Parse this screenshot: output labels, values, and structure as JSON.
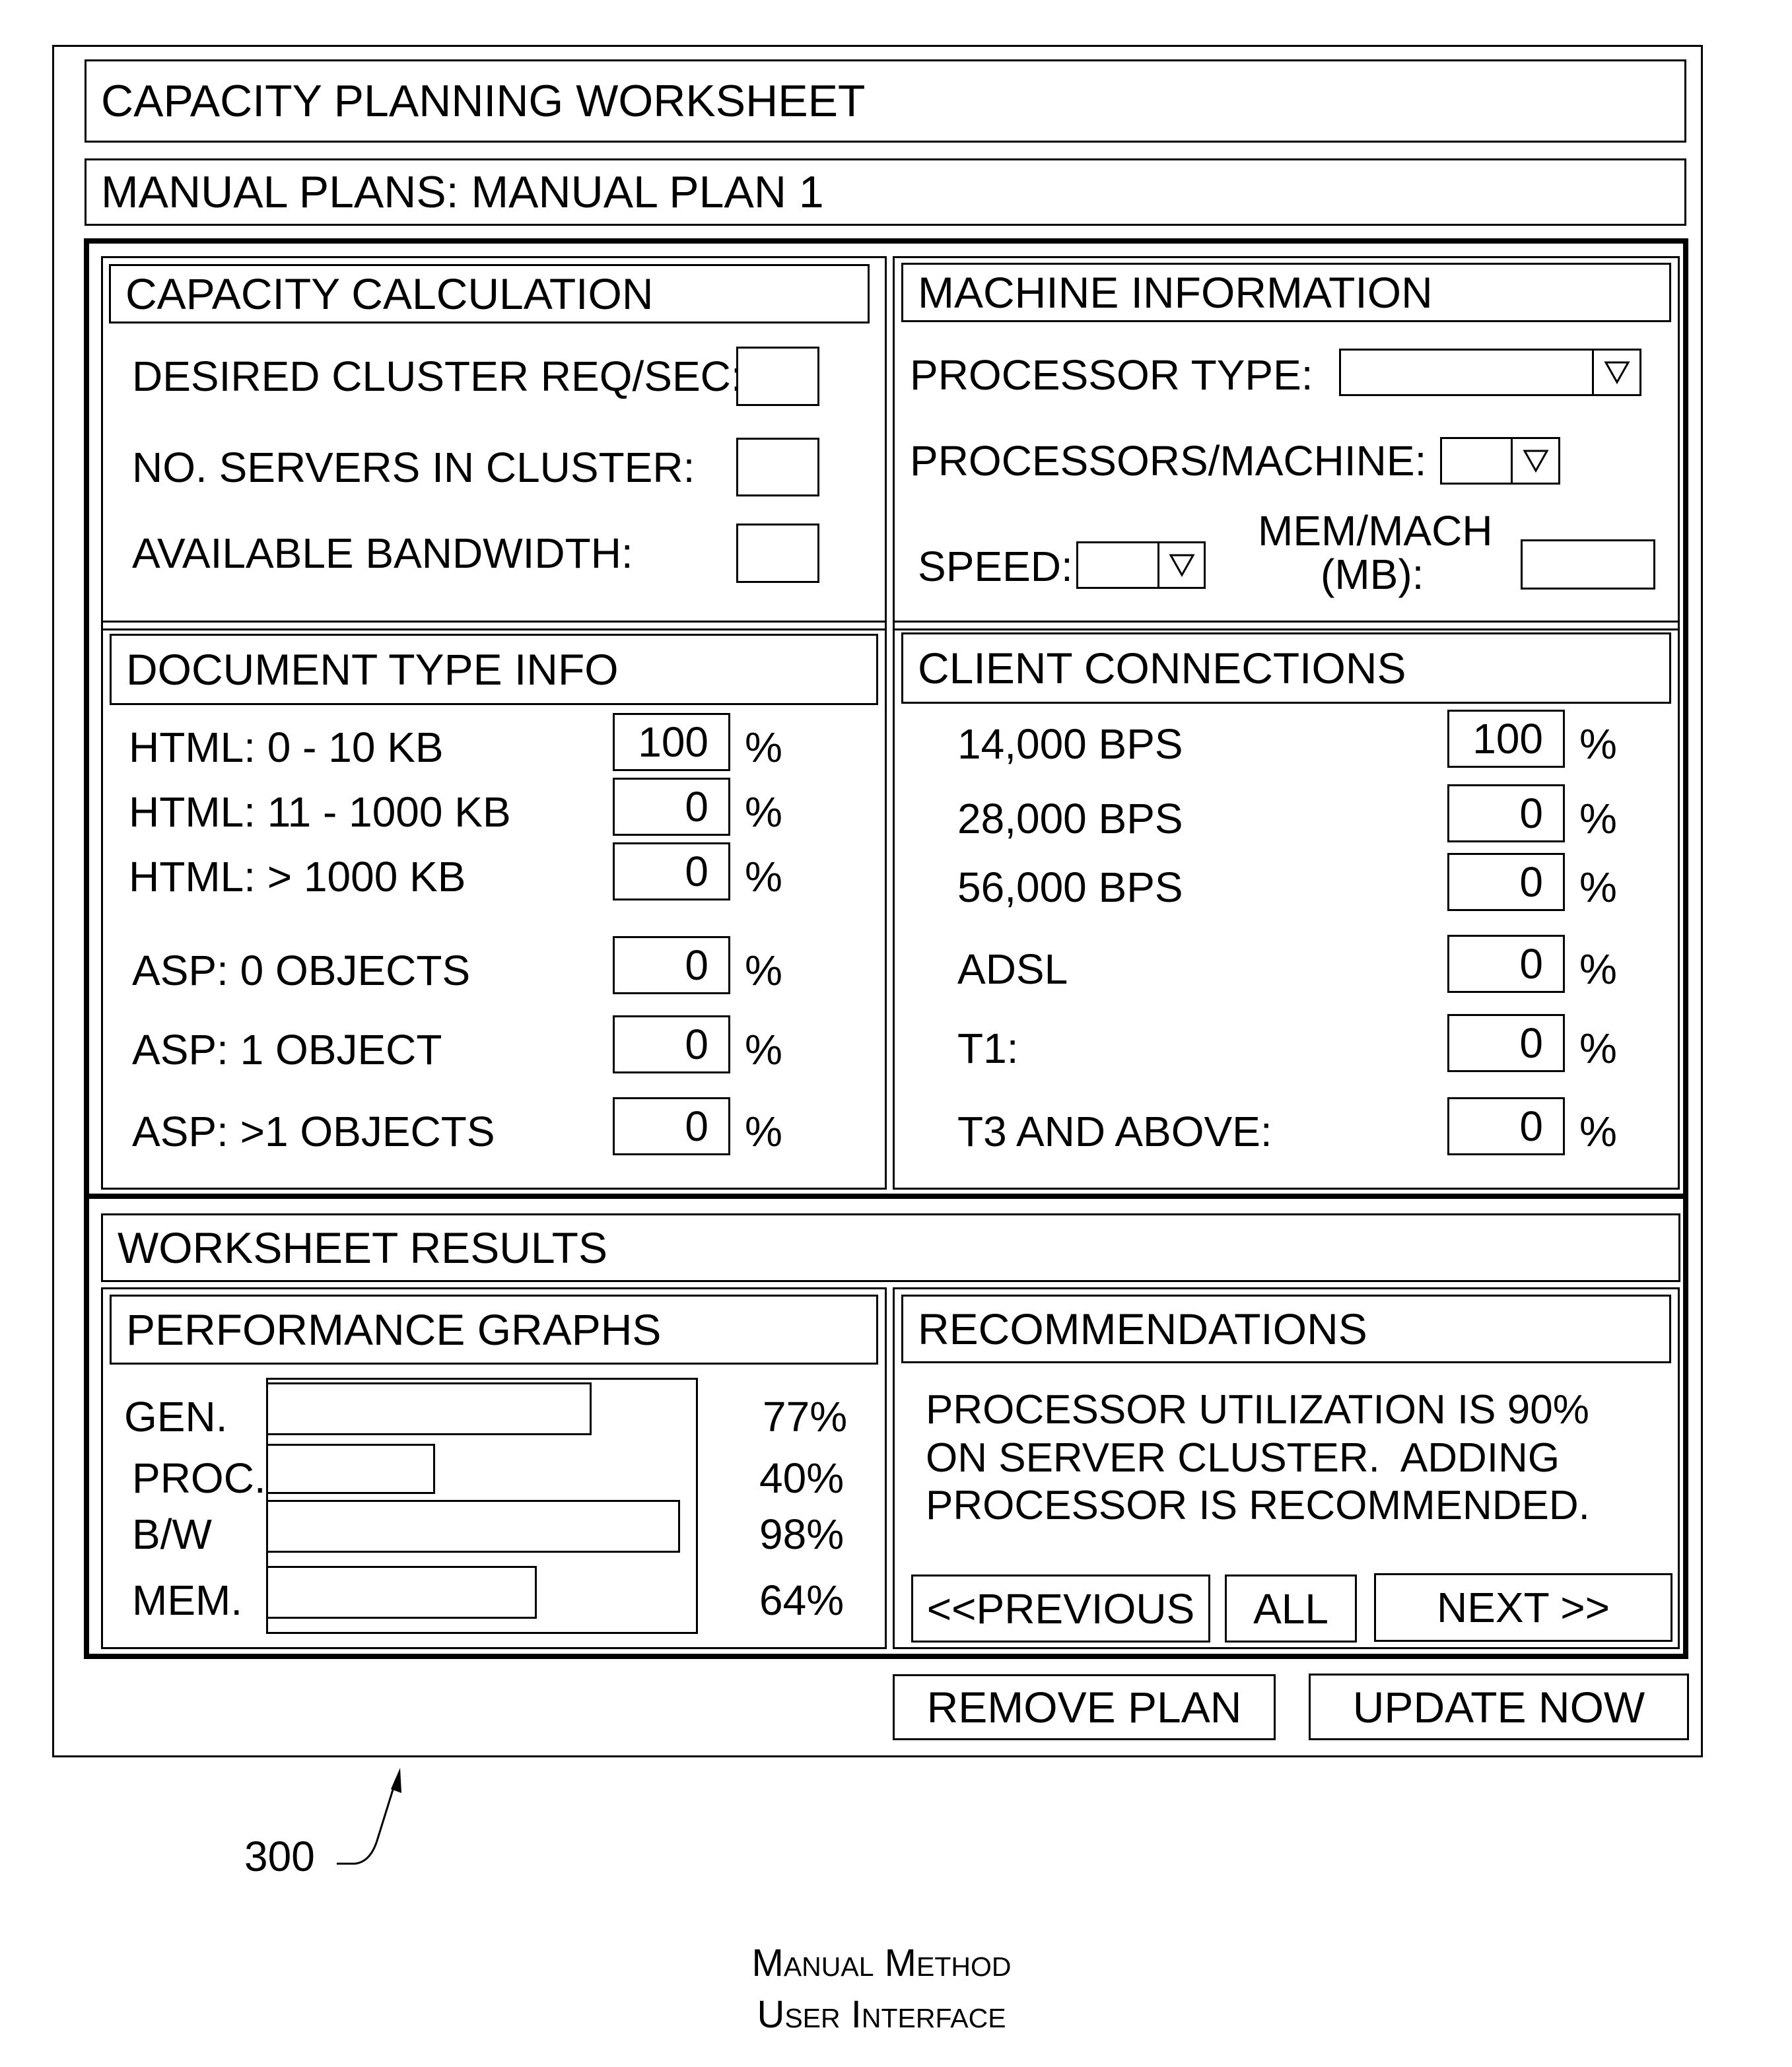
{
  "window": {
    "title": "CAPACITY PLANNING WORKSHEET",
    "plan_label": "MANUAL PLANS: MANUAL PLAN 1"
  },
  "capacity_calculation": {
    "header": "CAPACITY CALCULATION",
    "fields": [
      {
        "label": "DESIRED CLUSTER REQ/SEC:",
        "value": ""
      },
      {
        "label": "NO. SERVERS IN CLUSTER:",
        "value": ""
      },
      {
        "label": "AVAILABLE BANDWIDTH:",
        "value": ""
      }
    ]
  },
  "machine_information": {
    "header": "MACHINE INFORMATION",
    "processor_type": {
      "label": "PROCESSOR TYPE:",
      "value": ""
    },
    "processors_per_machine": {
      "label": "PROCESSORS/MACHINE:",
      "value": ""
    },
    "speed": {
      "label": "SPEED:",
      "value": ""
    },
    "mem_per_machine": {
      "label_line1": "MEM/MACH",
      "label_line2": "(MB):",
      "value": ""
    },
    "dropdown_icon": "triangle-down-icon"
  },
  "document_type_info": {
    "header": "DOCUMENT TYPE INFO",
    "unit": "%",
    "rows": [
      {
        "label": "HTML: 0 - 10 KB",
        "value": "100"
      },
      {
        "label": "HTML: 11 - 1000 KB",
        "value": "0"
      },
      {
        "label": "HTML: > 1000 KB",
        "value": "0"
      },
      {
        "label": "ASP: 0 OBJECTS",
        "value": "0"
      },
      {
        "label": "ASP: 1 OBJECT",
        "value": "0"
      },
      {
        "label": "ASP: >1 OBJECTS",
        "value": "0"
      }
    ]
  },
  "client_connections": {
    "header": "CLIENT CONNECTIONS",
    "unit": "%",
    "rows": [
      {
        "label": "14,000 BPS",
        "value": "100"
      },
      {
        "label": "28,000 BPS",
        "value": "0"
      },
      {
        "label": "56,000 BPS",
        "value": "0"
      },
      {
        "label": "ADSL",
        "value": "0"
      },
      {
        "label": "T1:",
        "value": "0"
      },
      {
        "label": "T3 AND ABOVE:",
        "value": "0"
      }
    ]
  },
  "worksheet_results": {
    "header": "WORKSHEET RESULTS"
  },
  "performance_graphs": {
    "header": "PERFORMANCE GRAPHS",
    "bars": [
      {
        "label": "GEN.",
        "value": 77,
        "display": "77%"
      },
      {
        "label": "PROC.",
        "value": 40,
        "display": "40%"
      },
      {
        "label": "B/W",
        "value": 98,
        "display": "98%"
      },
      {
        "label": "MEM.",
        "value": 64,
        "display": "64%"
      }
    ]
  },
  "recommendations": {
    "header": "RECOMMENDATIONS",
    "lines": [
      "PROCESSOR UTILIZATION IS 90%",
      "ON SERVER CLUSTER.  ADDING",
      "PROCESSOR IS RECOMMENDED."
    ],
    "buttons": {
      "previous": "<<PREVIOUS",
      "all": "ALL",
      "next": "NEXT >>"
    }
  },
  "actions": {
    "remove_plan": "REMOVE PLAN",
    "update_now": "UPDATE NOW"
  },
  "figure": {
    "reference_number": "300",
    "caption_line1": "Manual Method",
    "caption_line2": "User Interface"
  }
}
